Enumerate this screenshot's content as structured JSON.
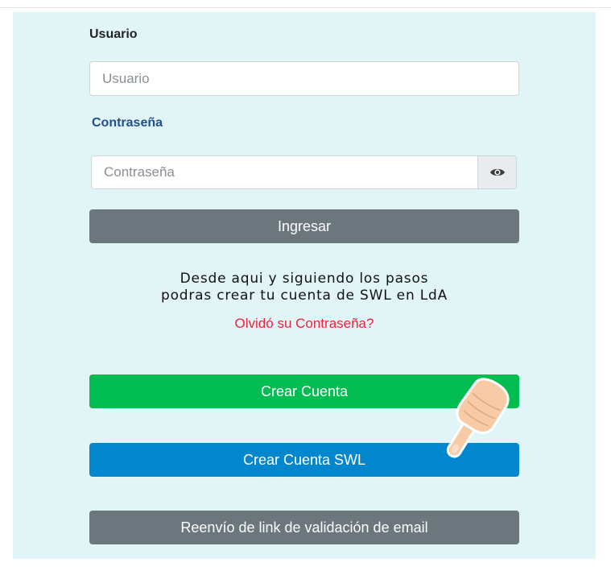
{
  "form": {
    "user_label": "Usuario",
    "user_placeholder": "Usuario",
    "password_label": "Contraseña",
    "password_placeholder": "Contraseña",
    "toggle_icon": "eye-icon",
    "login_button": "Ingresar"
  },
  "info": {
    "line1": "Desde aqui y siguiendo los pasos",
    "line2": "podras crear tu cuenta de SWL en LdA",
    "forgot_link": "Olvidó su Contraseña?"
  },
  "actions": {
    "create_account": "Crear Cuenta",
    "create_account_swl": "Crear Cuenta SWL",
    "resend_link": "Reenvío de link de validación de email"
  },
  "decor": {
    "pointer": "pointing-hand-icon"
  },
  "colors": {
    "panel_bg": "#e1f5f7",
    "gray_button": "#6b767d",
    "green_button": "#02bd52",
    "blue_button": "#0287cf",
    "link_red": "#f2213b",
    "password_label": "#1f4f8f"
  }
}
